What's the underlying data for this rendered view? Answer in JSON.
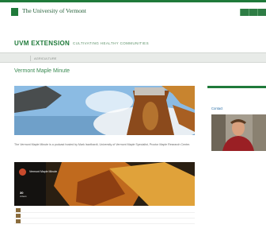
{
  "header": {
    "university_name": "The University of Vermont",
    "top_links": [
      "",
      "",
      ""
    ]
  },
  "banner": {
    "title": "UVM EXTENSION",
    "tagline": "CULTIVATING HEALTHY COMMUNITIES"
  },
  "nav": {
    "home_label": "",
    "section_label": "AGRICULTURE"
  },
  "page": {
    "title": "Vermont Maple Minute",
    "caption": "The Vermont Maple Minute is a podcast hosted by Mark Isselhardt, University of Vermont Maple Specialist, Proctor Maple Research Center."
  },
  "video": {
    "title": "Vermont Maple Minute",
    "count": "30",
    "count_label": "videos"
  },
  "playlist": [
    {
      "label": "",
      "duration": ""
    },
    {
      "label": "",
      "duration": ""
    },
    {
      "label": "",
      "duration": ""
    }
  ],
  "sidebar": {
    "heading": "",
    "name": "Contact",
    "link": "",
    "text": ""
  },
  "colors": {
    "brand_green": "#1f7a3a",
    "link_blue": "#2a6fa8"
  }
}
